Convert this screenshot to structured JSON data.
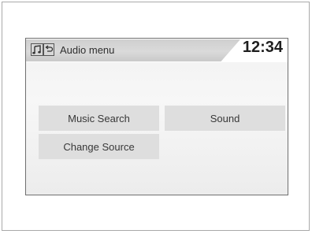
{
  "header": {
    "icons": [
      "music-note-icon",
      "back-icon"
    ],
    "title": "Audio menu",
    "clock": "12:34"
  },
  "menu": {
    "items": [
      {
        "label": "Music Search"
      },
      {
        "label": "Sound"
      },
      {
        "label": "Change Source"
      }
    ]
  },
  "colors": {
    "header_bar": "#d4d4d4",
    "button_bg": "#dedede",
    "screen_bg": "#f2f2f2",
    "text": "#2e2e2e"
  }
}
